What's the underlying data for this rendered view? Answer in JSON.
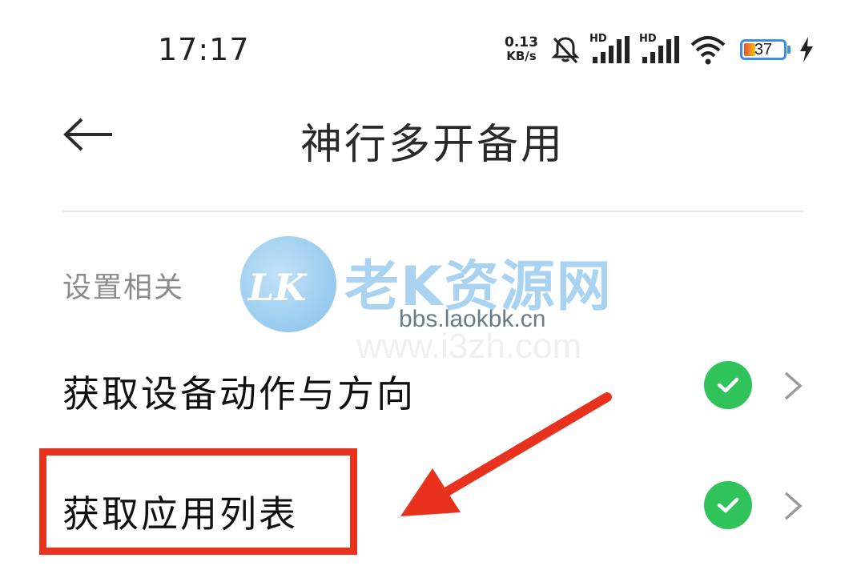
{
  "status_bar": {
    "time": "17:17",
    "net_speed_value": "0.13",
    "net_speed_unit": "KB/s",
    "signal1_label": "HD",
    "signal2_label": "HD",
    "battery_level": "37"
  },
  "header": {
    "title": "神行多开备用"
  },
  "section": {
    "label": "设置相关"
  },
  "items": [
    {
      "label": "获取设备动作与方向"
    },
    {
      "label": "获取应用列表"
    }
  ],
  "watermark": {
    "logo_text": "LK",
    "brand": "老K资源网",
    "url": "bbs.laokbk.cn",
    "url2": "www.i3zh.com"
  },
  "colors": {
    "accent_green": "#2fc35a",
    "highlight_red": "#e8321e",
    "battery_blue": "#3a8ee6"
  },
  "icons": {
    "back": "arrow-left-icon",
    "mute": "bell-muted-icon",
    "wifi": "wifi-icon",
    "charging": "lightning-icon",
    "check": "check-icon",
    "chevron": "chevron-right-icon"
  }
}
